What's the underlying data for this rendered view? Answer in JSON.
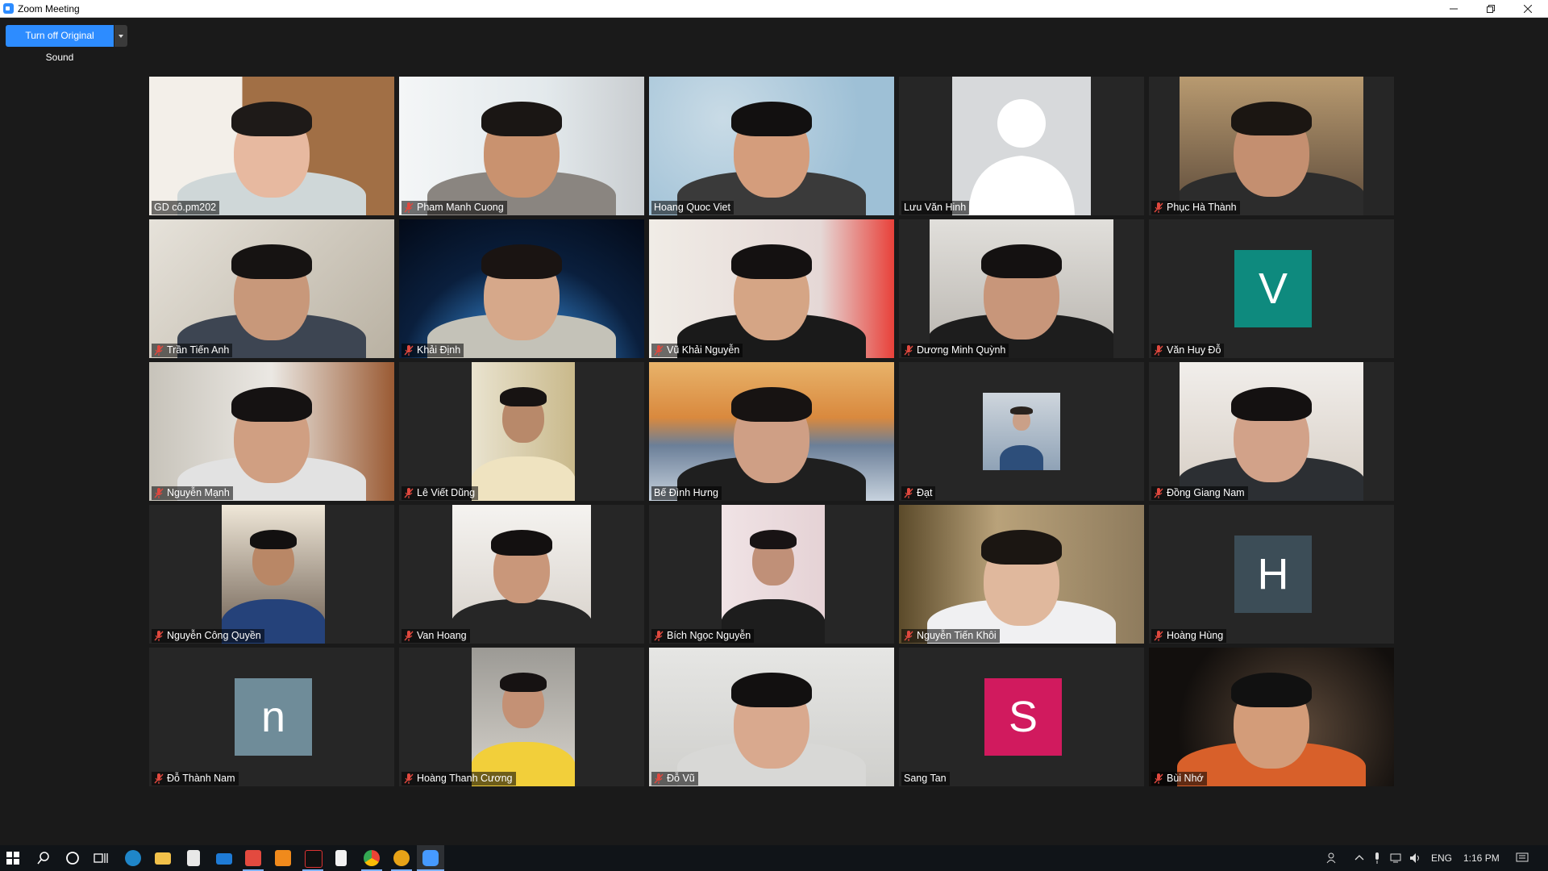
{
  "window": {
    "title": "Zoom Meeting"
  },
  "toolbar": {
    "sound_label": "Turn off Original Sound"
  },
  "participants": [
    {
      "name": "GD cô.pm202",
      "muted": false,
      "active": true,
      "video": true
    },
    {
      "name": "Pham Manh Cuong",
      "muted": true,
      "video": true
    },
    {
      "name": "Hoang Quoc Viet",
      "muted": false,
      "video": true
    },
    {
      "name": "Lưu Văn Hinh",
      "muted": false,
      "video": false,
      "avatar_type": "silhouette"
    },
    {
      "name": "Phục Hà Thành",
      "muted": true,
      "video": true
    },
    {
      "name": "Trần Tiến Anh",
      "muted": true,
      "video": true
    },
    {
      "name": "Khải Định",
      "muted": true,
      "video": true
    },
    {
      "name": "Vũ Khải Nguyễn",
      "muted": true,
      "video": true
    },
    {
      "name": "Dương Minh Quỳnh",
      "muted": true,
      "video": true
    },
    {
      "name": "Văn Huy Đỗ",
      "muted": true,
      "video": false,
      "initial": "V",
      "avatar_color": "#0e8a7e"
    },
    {
      "name": "Nguyễn Mạnh",
      "muted": true,
      "video": true
    },
    {
      "name": "Lê Viết Dũng",
      "muted": true,
      "video": true
    },
    {
      "name": "Bế Đình Hưng",
      "muted": false,
      "video": true
    },
    {
      "name": "Đạt",
      "muted": true,
      "video": true
    },
    {
      "name": "Đồng Giang Nam",
      "muted": true,
      "video": true
    },
    {
      "name": "Nguyễn Công Quyền",
      "muted": true,
      "video": true
    },
    {
      "name": "Van Hoang",
      "muted": true,
      "video": true
    },
    {
      "name": "Bích Ngọc Nguyễn",
      "muted": true,
      "video": true
    },
    {
      "name": "Nguyễn Tiến Khôi",
      "muted": true,
      "video": true
    },
    {
      "name": "Hoàng Hùng",
      "muted": true,
      "video": false,
      "initial": "H",
      "avatar_color": "#3c4d57"
    },
    {
      "name": "Đỗ Thành Nam",
      "muted": true,
      "video": false,
      "initial": "n",
      "avatar_color": "#6f8c99"
    },
    {
      "name": "Hoàng Thanh Cương",
      "muted": true,
      "video": true
    },
    {
      "name": "Đỗ Vũ",
      "muted": true,
      "video": true
    },
    {
      "name": "Sang Tan",
      "muted": false,
      "video": false,
      "initial": "S",
      "avatar_color": "#d11a5e"
    },
    {
      "name": "Bùi Nhớ",
      "muted": true,
      "video": true
    }
  ],
  "taskbar": {
    "language": "ENG",
    "time": "1:16 PM"
  },
  "colors": {
    "accent": "#2d8cff",
    "active_speaker": "#c8e94a",
    "muted_icon": "#e0483e"
  }
}
